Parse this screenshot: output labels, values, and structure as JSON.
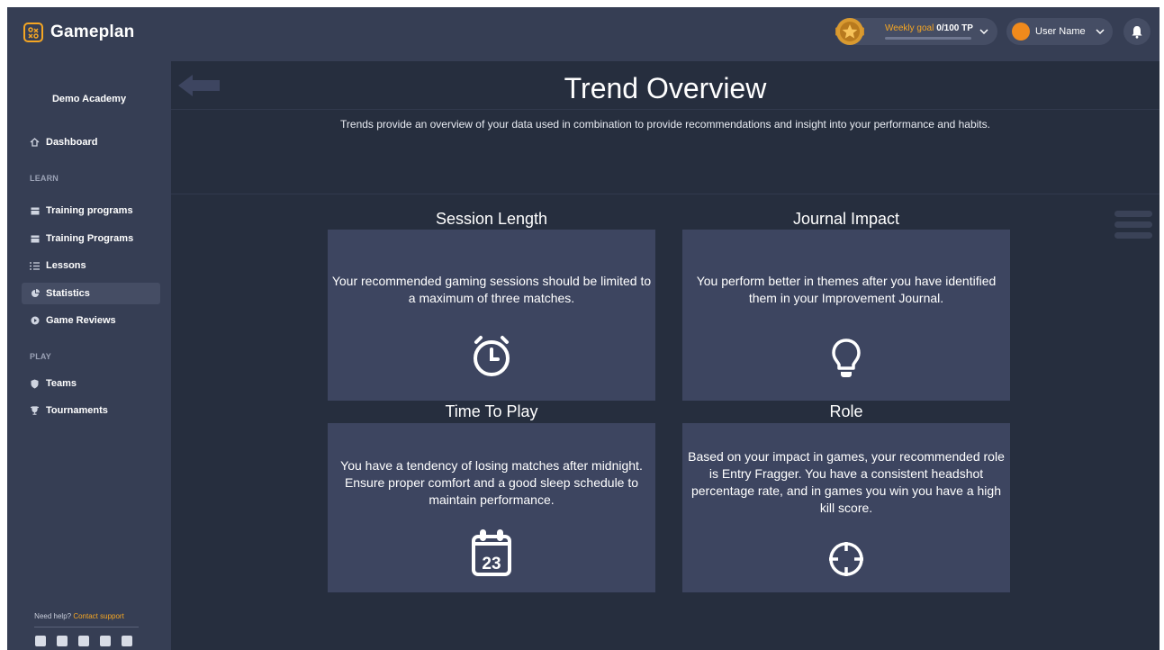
{
  "app": {
    "name": "Gameplan"
  },
  "header": {
    "weekly_goal_label": "Weekly goal",
    "weekly_goal_value": "0/100 TP",
    "weekly_goal_progress": 0,
    "user_name": "User Name"
  },
  "sidebar": {
    "academy": "Demo Academy",
    "items": [
      {
        "label": "Dashboard",
        "icon": "home-icon"
      },
      {
        "label": "Training programs",
        "icon": "calendar-icon"
      },
      {
        "label": "Training Programs",
        "icon": "calendar-icon"
      },
      {
        "label": "Lessons",
        "icon": "list-icon"
      },
      {
        "label": "Statistics",
        "icon": "pie-chart-icon",
        "active": true
      },
      {
        "label": "Game Reviews",
        "icon": "play-icon"
      },
      {
        "label": "Teams",
        "icon": "shield-icon"
      },
      {
        "label": "Tournaments",
        "icon": "trophy-icon"
      }
    ],
    "sections": {
      "learn": "LEARN",
      "play": "PLAY"
    },
    "help_text": "Need help?",
    "help_link": "Contact support",
    "socials": [
      "instagram-icon",
      "twitter-icon",
      "facebook-icon",
      "twitch-icon",
      "tiktok-icon"
    ]
  },
  "main": {
    "title": "Trend Overview",
    "subtitle": "Trends provide an overview of your data used in combination to provide recommendations and insight into your performance and habits.",
    "cards": [
      {
        "title": "Session Length",
        "text": "Your recommended gaming sessions should be limited to a maximum of three matches.",
        "icon": "stopwatch-icon"
      },
      {
        "title": "Journal Impact",
        "text": "You perform better in themes after you have identified them in your Improvement Journal.",
        "icon": "lightbulb-icon"
      },
      {
        "title": "Time To Play",
        "text": "You have a tendency of losing matches after midnight. Ensure proper comfort and a good sleep schedule to maintain performance.",
        "icon": "calendar-icon",
        "icon_text": "23"
      },
      {
        "title": "Role",
        "text": "Based on your impact in games, your recommended role is Entry Fragger. You have a consistent headshot percentage rate, and in games you win you have a high kill score.",
        "icon": "crosshair-icon"
      }
    ]
  },
  "colors": {
    "background": "#262e3e",
    "panel": "#363e54",
    "card": "#3d4560",
    "accent": "#f5a623"
  }
}
